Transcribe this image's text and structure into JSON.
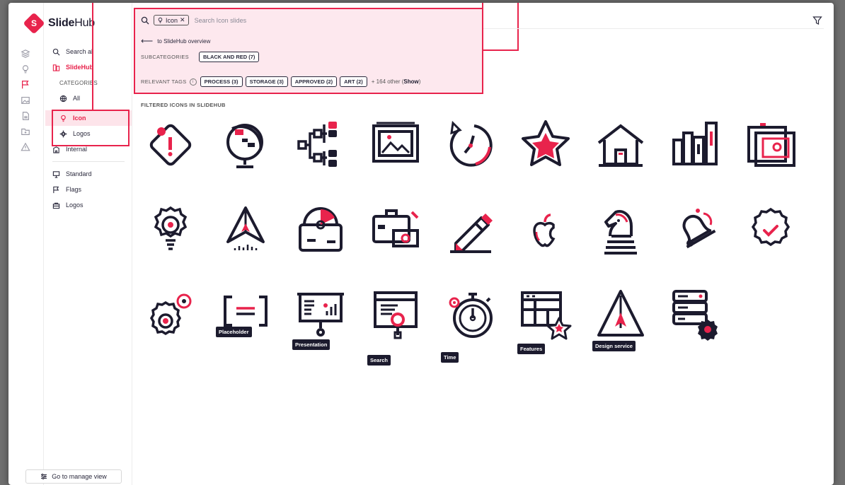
{
  "brand": {
    "name_bold": "Slide",
    "name_rest": "Hub",
    "mark": "S"
  },
  "sidebar": {
    "search_label": "Search al",
    "root_label": "SlideHub",
    "categories_label": "CATEGORIES",
    "items": [
      {
        "label": "All",
        "icon": "globe-icon"
      },
      {
        "label": "Icon",
        "icon": "lightbulb-icon",
        "active": true
      },
      {
        "label": "Logos",
        "icon": "gear-icon"
      },
      {
        "label": "Internal",
        "icon": "building-icon"
      }
    ],
    "extra_items": [
      {
        "label": "Standard",
        "icon": "presentation-icon"
      },
      {
        "label": "Flags",
        "icon": "flag-icon"
      },
      {
        "label": "Logos",
        "icon": "briefcase-icon"
      }
    ],
    "manage_label": "Go to manage view"
  },
  "search": {
    "chip_label": "Icon",
    "chip_close": "✕",
    "placeholder": "Search Icon slides",
    "back_label": "to SlideHub overview"
  },
  "subcategories": {
    "label": "SUBCATEGORIES",
    "items": [
      "BLACK AND RED (7)"
    ]
  },
  "relevant_tags": {
    "label": "RELEVANT TAGS",
    "items": [
      "PROCESS (3)",
      "STORAGE (3)",
      "APPROVED (2)",
      "ART (2)"
    ],
    "more_prefix": "+ 164 other (",
    "more_link": "Show",
    "more_suffix": ")"
  },
  "section_title": "FILTERED ICONS IN SLIDEHUB",
  "icons": [
    {
      "name": "warning-tag-icon"
    },
    {
      "name": "globe-stand-icon"
    },
    {
      "name": "hierarchy-icon"
    },
    {
      "name": "image-frame-icon"
    },
    {
      "name": "clock-refresh-icon"
    },
    {
      "name": "star-icon"
    },
    {
      "name": "house-icon"
    },
    {
      "name": "books-icon"
    },
    {
      "name": "photos-icon"
    },
    {
      "name": "lightbulb-gear-icon"
    },
    {
      "name": "paper-plane-icon"
    },
    {
      "name": "cd-box-icon"
    },
    {
      "name": "briefcase-money-icon"
    },
    {
      "name": "marker-icon"
    },
    {
      "name": "apple-icon"
    },
    {
      "name": "chess-knight-icon"
    },
    {
      "name": "bell-icon"
    },
    {
      "name": "check-badge-icon"
    },
    {
      "name": "gears-icon"
    },
    {
      "name": "placeholder-icon",
      "label": "Placeholder"
    },
    {
      "name": "presentation-board-icon",
      "label": "Presentation"
    },
    {
      "name": "search-browser-icon",
      "label": "Search"
    },
    {
      "name": "stopwatch-icon",
      "label": "Time"
    },
    {
      "name": "features-icon",
      "label": "Features"
    },
    {
      "name": "design-service-icon",
      "label": "Design service"
    },
    {
      "name": "server-gear-icon"
    }
  ],
  "colors": {
    "accent": "#e8234c",
    "ink": "#1c1b2e",
    "highlight": "#fde4ea"
  }
}
